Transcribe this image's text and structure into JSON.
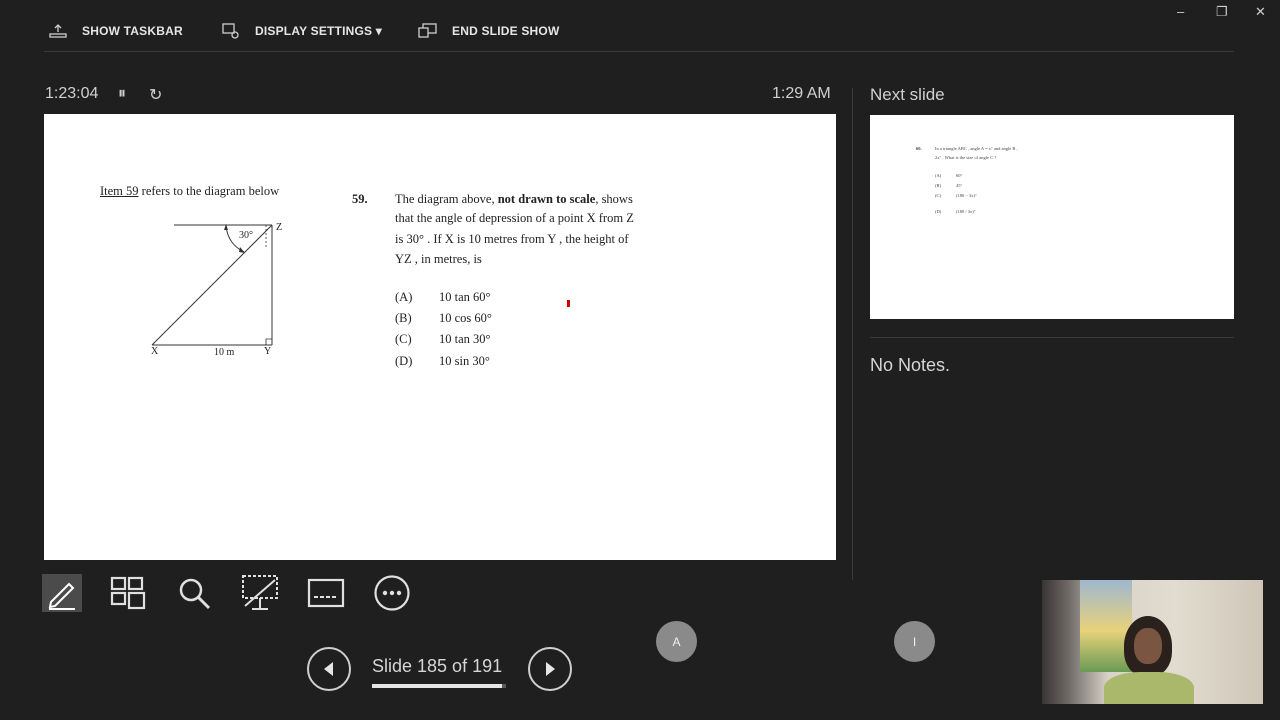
{
  "window": {
    "minimize_icon": "minimize-icon",
    "restore_icon": "restore-icon",
    "close_icon": "close-icon"
  },
  "toolbar": {
    "show_taskbar": "SHOW TASKBAR",
    "display_settings": "DISPLAY SETTINGS ▾",
    "end_slide_show": "END SLIDE SHOW"
  },
  "timer": {
    "elapsed": "1:23:04",
    "pause_glyph": "⏸",
    "restart_glyph": "↻",
    "clock": "1:29 AM"
  },
  "next_slide": {
    "header": "Next slide",
    "num": "60.",
    "q1": "In a triangle ABC , angle  A = x° and angle  B ,",
    "q2": "2x° . What is the size of angle  C ?",
    "options": [
      {
        "label": "(A)",
        "value": "60°"
      },
      {
        "label": "(B)",
        "value": "45°"
      },
      {
        "label": "(C)",
        "value": "(180 − 3x)°"
      },
      {
        "label": "(D)",
        "value": "(180 / 3x)°"
      }
    ]
  },
  "notes": "No Notes.",
  "slide": {
    "item_ref": "Item 59",
    "item_rest": " refers to the diagram below",
    "diagram": {
      "angle": "30°",
      "z": "Z",
      "x": "X",
      "y": "Y",
      "base": "10 m"
    },
    "q_num": "59.",
    "q_line1a": "The diagram above, ",
    "q_line1b": "not drawn to scale",
    "q_line1c": ", shows",
    "q_line2": "that the angle of depression of a point  X  from  Z",
    "q_line3": "is 30° . If  X  is 10 metres from Y , the height of",
    "q_line4": "YZ , in metres, is",
    "options": [
      {
        "label": "(A)",
        "value": "10 tan 60°"
      },
      {
        "label": "(B)",
        "value": "10 cos 60°"
      },
      {
        "label": "(C)",
        "value": "10 tan 30°"
      },
      {
        "label": "(D)",
        "value": "10 sin 30°"
      }
    ]
  },
  "tools": [
    "pen-tool",
    "see-all-slides",
    "zoom",
    "black-screen",
    "subtitles",
    "more-options"
  ],
  "nav": {
    "counter": "Slide 185 of 191",
    "progress": 0.9686
  },
  "circles": {
    "a": "A",
    "i": "I"
  },
  "colors": {
    "bg": "#1f1f1f",
    "slide_bg": "#ffffff",
    "pointer": "#d00000"
  }
}
